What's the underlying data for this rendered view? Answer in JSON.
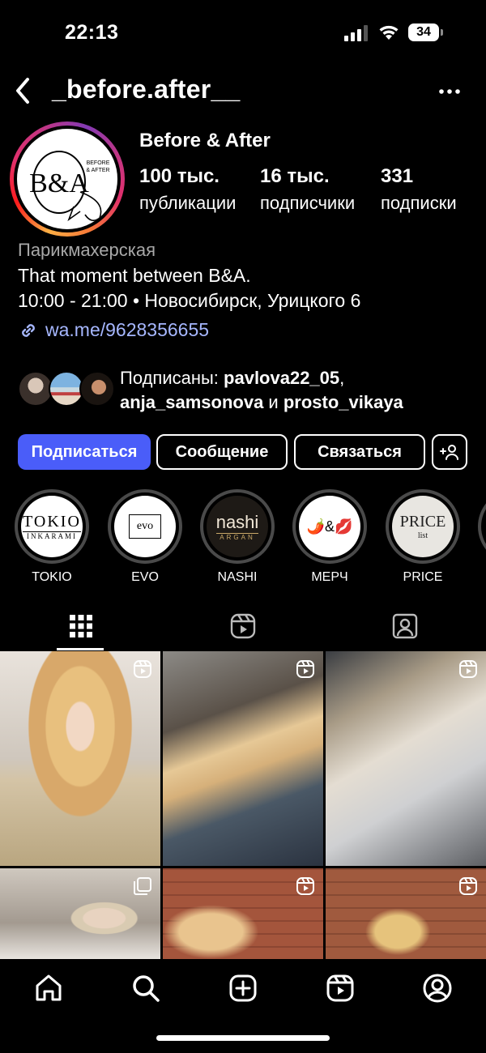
{
  "status": {
    "time": "22:13",
    "battery": "34"
  },
  "header": {
    "username": "_before.after__"
  },
  "profile": {
    "avatar_text_main": "B&A",
    "avatar_text_small_1": "BEFORE",
    "avatar_text_small_2": "& AFTER",
    "display_name": "Before & After",
    "stats": [
      {
        "num": "100 тыс.",
        "label": "публикации"
      },
      {
        "num": "16 тыс.",
        "label": "подписчики"
      },
      {
        "num": "331",
        "label": "подписки"
      }
    ],
    "category": "Парикмахерская",
    "bio_line1": "That moment between B&A.",
    "bio_line2": "10:00 - 21:00 • Новосибирск, Урицкого 6",
    "link": "wa.me/9628356655"
  },
  "followed_by": {
    "prefix": "Подписаны: ",
    "user1": "pavlova22_05",
    "comma": ",",
    "user2": "anja_samsonova",
    "and": " и ",
    "user3": "prosto_vikaya"
  },
  "buttons": {
    "follow": "Подписаться",
    "message": "Сообщение",
    "contact": "Связаться",
    "add": "+"
  },
  "highlights": [
    {
      "label": "TOKIO",
      "logo_line1": "TOKIO",
      "logo_line2": "INKARAMI"
    },
    {
      "label": "EVO",
      "logo_line1": "evo"
    },
    {
      "label": "NASHI",
      "logo_line1": "nashi",
      "logo_line2": "ARGAN"
    },
    {
      "label": "МЕРЧ",
      "logo_line1": "🌶️&💋"
    },
    {
      "label": "PRICE",
      "logo_line1": "PRICE",
      "logo_line2": "list"
    }
  ],
  "tabs": [
    "grid",
    "reels",
    "tagged"
  ],
  "colors": {
    "follow": "#4a5df9",
    "link": "#a6b7ff",
    "muted": "#a8a8a8"
  }
}
